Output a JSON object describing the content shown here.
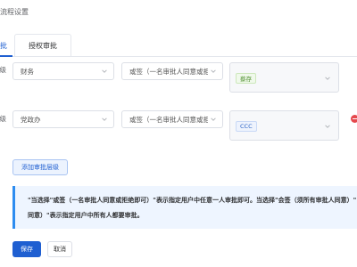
{
  "header": {
    "title": "审批流程设置"
  },
  "tabs": [
    {
      "label": "审批"
    },
    {
      "label": "授权审批"
    }
  ],
  "rows": [
    {
      "label": "一级",
      "department": "财务",
      "sign_mode": "或签（一名审批人同意或拒绝即可）",
      "approver_tag": "蔡存"
    },
    {
      "label": "二级",
      "department": "党政办",
      "sign_mode": "或签（一名审批人同意或拒绝即可）",
      "approver_tag": "CCC"
    }
  ],
  "add_level_label": "添加审批层级",
  "notice": {
    "line1": "\"当选择\"或签（一名审批人同意或拒绝即可）\"表示指定用户中任意一人审批即可。当选择\"会签（须所有审批人同意）\"",
    "line2": "同意）\"表示指定用户中所有人都要审批。"
  },
  "actions": {
    "save": "保存",
    "cancel": "取消"
  },
  "colors": {
    "primary": "#1f5fd1",
    "danger": "#e5484d",
    "notice_bg": "#eef5ff",
    "notice_accent": "#2d8cf0"
  }
}
